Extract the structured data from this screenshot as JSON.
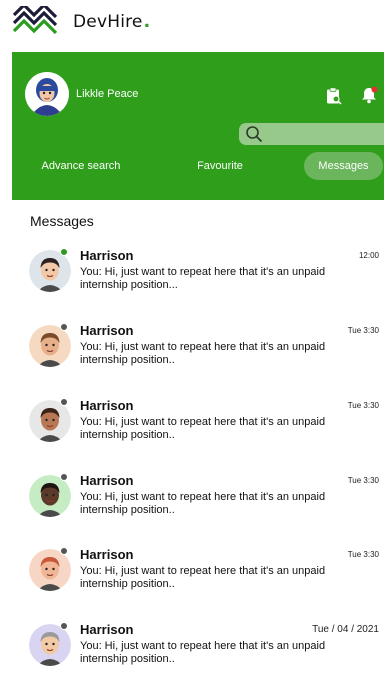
{
  "app": {
    "brand": "DevHire",
    "brand_dot": "."
  },
  "colors": {
    "primary": "#2e9e1b",
    "tab_active": "#6bb55c",
    "search_bg": "#96c98a",
    "online": "#2a9d1f",
    "offline": "#555555"
  },
  "header": {
    "user_name": "Likkle Peace",
    "icons": [
      "clipboard-search-icon",
      "bell-notification-icon"
    ],
    "search": {
      "placeholder": ""
    },
    "tabs": [
      {
        "label": "Advance search",
        "active": false
      },
      {
        "label": "Favourite",
        "active": false
      },
      {
        "label": "Messages",
        "active": true
      }
    ]
  },
  "messages_section": {
    "title": "Messages",
    "items": [
      {
        "name": "Harrison",
        "time": "12:00",
        "preview": "You: Hi, just want to repeat here that it's an unpaid internship position...",
        "online": true,
        "avatar_bg": "#dde4ea",
        "skin": "#f2c9a7",
        "hair": "#2b2220"
      },
      {
        "name": "Harrison",
        "time": "Tue 3:30",
        "preview": "You: Hi, just want to repeat here that it's an unpaid internship position..",
        "online": false,
        "avatar_bg": "#f6d9c1",
        "skin": "#e8b08a",
        "hair": "#7a4a2a"
      },
      {
        "name": "Harrison",
        "time": "Tue 3:30",
        "preview": "You: Hi, just want to repeat here that it's an unpaid internship position..",
        "online": false,
        "avatar_bg": "#e7e7e7",
        "skin": "#b97855",
        "hair": "#3a2418"
      },
      {
        "name": "Harrison",
        "time": "Tue 3:30",
        "preview": "You: Hi, just want to repeat here that it's an unpaid internship position..",
        "online": false,
        "avatar_bg": "#c6ecc4",
        "skin": "#5b3a2a",
        "hair": "#1c1410"
      },
      {
        "name": "Harrison",
        "time": "Tue 3:30",
        "preview": "You: Hi, just want to repeat here that it's an unpaid internship position..",
        "online": false,
        "avatar_bg": "#f8d6c6",
        "skin": "#f0b696",
        "hair": "#c9583a"
      },
      {
        "name": "Harrison",
        "time": "Tue / 04 / 2021",
        "preview": "You: Hi, just want to repeat here that it's an unpaid internship position..",
        "online": false,
        "avatar_bg": "#d9d4f2",
        "skin": "#f1c9a5",
        "hair": "#9a9a9a"
      }
    ]
  }
}
